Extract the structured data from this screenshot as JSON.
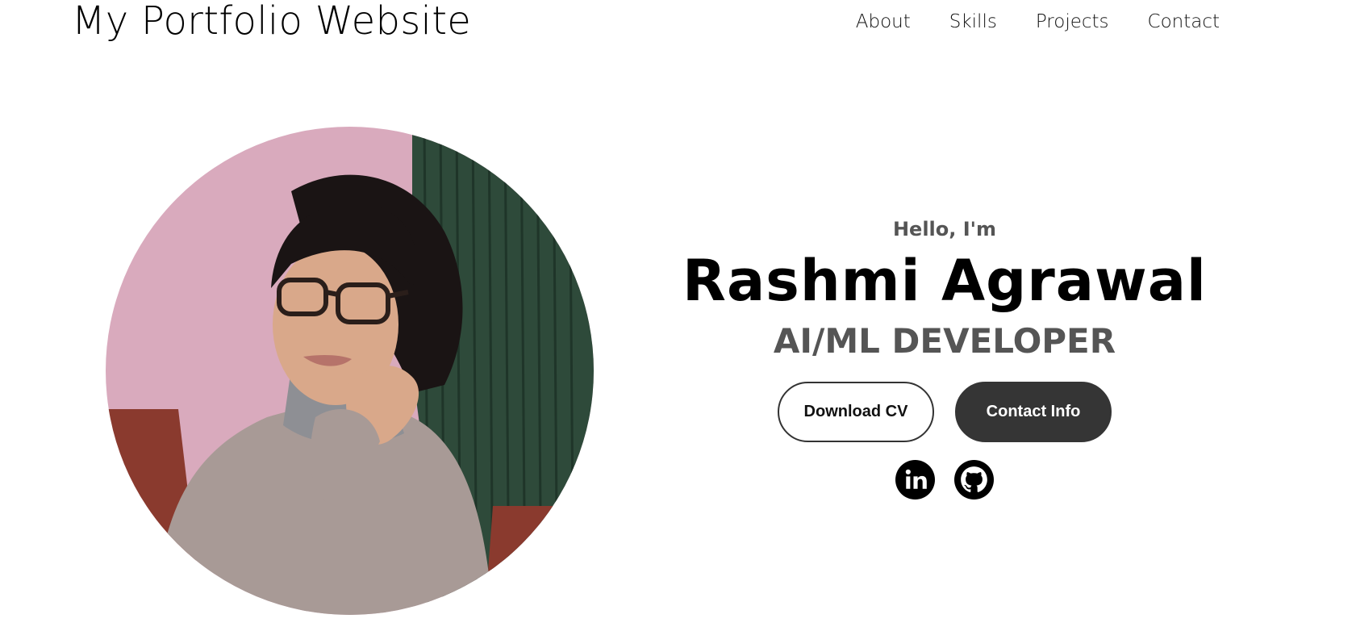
{
  "header": {
    "title": "My Portfolio Website",
    "nav": [
      {
        "label": "About"
      },
      {
        "label": "Skills"
      },
      {
        "label": "Projects"
      },
      {
        "label": "Contact"
      }
    ]
  },
  "profile": {
    "image": "profile-photo"
  },
  "intro": {
    "greeting": "Hello, I'm",
    "name": "Rashmi Agrawal",
    "role": "AI/ML DEVELOPER",
    "buttons": {
      "download_cv": "Download CV",
      "contact_info": "Contact Info"
    },
    "socials": [
      {
        "icon": "linkedin-icon"
      },
      {
        "icon": "github-icon"
      }
    ]
  },
  "colors": {
    "accent_dark": "#353535",
    "subtitle_gray": "#555555"
  }
}
